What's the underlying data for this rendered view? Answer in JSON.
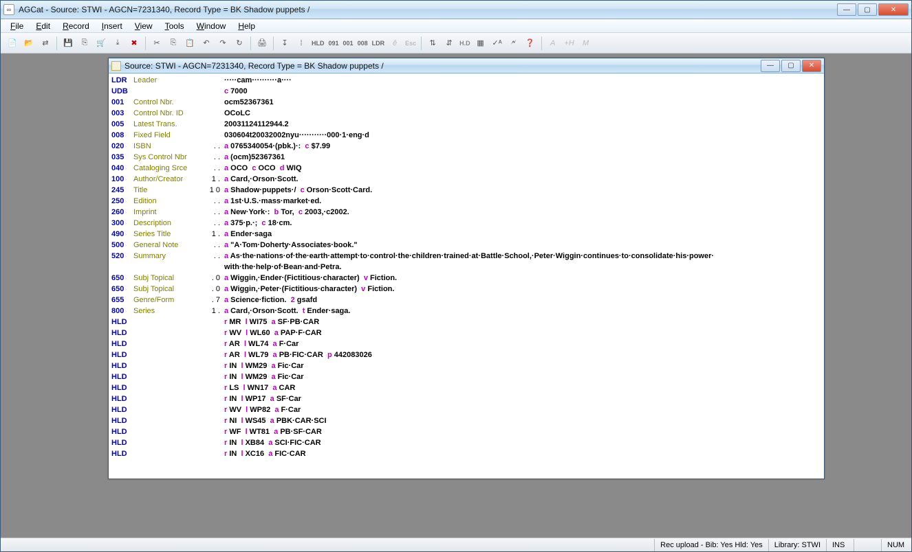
{
  "app": {
    "title": "AGCat - Source: STWI - AGCN=7231340,  Record Type = BK Shadow puppets /",
    "icon_label": "∞"
  },
  "menu": {
    "file": "File",
    "edit": "Edit",
    "record": "Record",
    "insert": "Insert",
    "view": "View",
    "tools": "Tools",
    "window": "Window",
    "help": "Help"
  },
  "toolbar_labels": {
    "hld": "HLD",
    "n091": "091",
    "n001": "001",
    "n008": "008",
    "ldr": "LDR",
    "esc": "Esc"
  },
  "doc": {
    "title": "Source: STWI - AGCN=7231340,  Record Type = BK Shadow puppets /"
  },
  "fields": [
    {
      "tag": "LDR",
      "label": "Leader",
      "ind": "",
      "data": "·····cam··········a····"
    },
    {
      "tag": "UDB",
      "label": "",
      "ind": "",
      "data": "<sf>c</sf> 7000"
    },
    {
      "tag": "001",
      "label": "Control Nbr.",
      "ind": "",
      "data": "ocm52367361"
    },
    {
      "tag": "003",
      "label": "Control Nbr. ID",
      "ind": "",
      "data": "OCoLC"
    },
    {
      "tag": "005",
      "label": "Latest Trans.",
      "ind": "",
      "data": "20031124112944.2"
    },
    {
      "tag": "008",
      "label": "Fixed Field",
      "ind": "",
      "data": "030604t20032002nyu···········000·1·eng·d"
    },
    {
      "tag": "020",
      "label": "ISBN",
      "ind": ". .",
      "data": "<sf>a</sf> 0765340054·(pbk.)·:  <sf>c</sf> $7.99"
    },
    {
      "tag": "035",
      "label": "Sys Control Nbr",
      "ind": ". .",
      "data": "<sf>a</sf> (ocm)52367361"
    },
    {
      "tag": "040",
      "label": "Cataloging Srce",
      "ind": ". .",
      "data": "<sf>a</sf> OCO  <sf>c</sf> OCO  <sf>d</sf> WIQ"
    },
    {
      "tag": "100",
      "label": "Author/Creator",
      "ind": "1 .",
      "data": "<sf>a</sf> Card,·Orson·Scott."
    },
    {
      "tag": "245",
      "label": "Title",
      "ind": "1 0",
      "data": "<sf>a</sf> Shadow·puppets·/  <sf>c</sf> Orson·Scott·Card."
    },
    {
      "tag": "250",
      "label": "Edition",
      "ind": ". .",
      "data": "<sf>a</sf> 1st·U.S.·mass·market·ed."
    },
    {
      "tag": "260",
      "label": "Imprint",
      "ind": ". .",
      "data": "<sf>a</sf> New·York·:  <sf>b</sf> Tor,  <sf>c</sf> 2003,·c2002."
    },
    {
      "tag": "300",
      "label": "Description",
      "ind": ". .",
      "data": "<sf>a</sf> 375·p.·;  <sf>c</sf> 18·cm."
    },
    {
      "tag": "490",
      "label": "Series Title",
      "ind": "1 .",
      "data": "<sf>a</sf> Ender·saga"
    },
    {
      "tag": "500",
      "label": "General Note",
      "ind": ". .",
      "data": "<sf>a</sf> \"A·Tom·Doherty·Associates·book.\""
    },
    {
      "tag": "520",
      "label": "Summary",
      "ind": ". .",
      "data": "<sf>a</sf> As·the·nations·of·the·earth·attempt·to·control·the·children·trained·at·Battle·School,·Peter·Wiggin·continues·to·consolidate·his·power·",
      "wrap": "with·the·help·of·Bean·and·Petra."
    },
    {
      "tag": "650",
      "label": "Subj Topical",
      "ind": ". 0",
      "data": "<sf>a</sf> Wiggin,·Ender·(Fictitious·character)  <sf>v</sf> Fiction."
    },
    {
      "tag": "650",
      "label": "Subj Topical",
      "ind": ". 0",
      "data": "<sf>a</sf> Wiggin,·Peter·(Fictitious·character)  <sf>v</sf> Fiction."
    },
    {
      "tag": "655",
      "label": "Genre/Form",
      "ind": ". 7",
      "data": "<sf>a</sf> Science·fiction.  <sf>2</sf> gsafd"
    },
    {
      "tag": "800",
      "label": "Series",
      "ind": "1 .",
      "data": "<sf>a</sf> Card,·Orson·Scott.  <sf>t</sf> Ender·saga."
    },
    {
      "tag": "HLD",
      "label": "",
      "ind": "",
      "data": "<sf>r</sf> MR  <sf>l</sf> WI75  <sf>a</sf> SF·PB·CAR"
    },
    {
      "tag": "HLD",
      "label": "",
      "ind": "",
      "data": "<sf>r</sf> WV  <sf>l</sf> WL60  <sf>a</sf> PAP·F·CAR"
    },
    {
      "tag": "HLD",
      "label": "",
      "ind": "",
      "data": "<sf>r</sf> AR  <sf>l</sf> WL74  <sf>a</sf> F·Car"
    },
    {
      "tag": "HLD",
      "label": "",
      "ind": "",
      "data": "<sf>r</sf> AR  <sf>l</sf> WL79  <sf>a</sf> PB·FIC·CAR  <sf>p</sf> 442083026"
    },
    {
      "tag": "HLD",
      "label": "",
      "ind": "",
      "data": "<sf>r</sf> IN  <sf>l</sf> WM29  <sf>a</sf> Fic·Car"
    },
    {
      "tag": "HLD",
      "label": "",
      "ind": "",
      "data": "<sf>r</sf> IN  <sf>l</sf> WM29  <sf>a</sf> Fic·Car"
    },
    {
      "tag": "HLD",
      "label": "",
      "ind": "",
      "data": "<sf>r</sf> LS  <sf>l</sf> WN17  <sf>a</sf> CAR"
    },
    {
      "tag": "HLD",
      "label": "",
      "ind": "",
      "data": "<sf>r</sf> IN  <sf>l</sf> WP17  <sf>a</sf> SF·Car"
    },
    {
      "tag": "HLD",
      "label": "",
      "ind": "",
      "data": "<sf>r</sf> WV  <sf>l</sf> WP82  <sf>a</sf> F·Car"
    },
    {
      "tag": "HLD",
      "label": "",
      "ind": "",
      "data": "<sf>r</sf> NI  <sf>l</sf> WS45  <sf>a</sf> PBK·CAR·SCI"
    },
    {
      "tag": "HLD",
      "label": "",
      "ind": "",
      "data": "<sf>r</sf> WF  <sf>l</sf> WT81  <sf>a</sf> PB·SF·CAR"
    },
    {
      "tag": "HLD",
      "label": "",
      "ind": "",
      "data": "<sf>r</sf> IN  <sf>l</sf> XB84  <sf>a</sf> SCI·FIC·CAR"
    },
    {
      "tag": "HLD",
      "label": "",
      "ind": "",
      "data": "<sf>r</sf> IN  <sf>l</sf> XC16  <sf>a</sf> FIC·CAR"
    }
  ],
  "status": {
    "rec_upload": "Rec upload - Bib: Yes  Hld: Yes",
    "library": "Library: STWI",
    "ins": "INS",
    "num": "NUM"
  }
}
